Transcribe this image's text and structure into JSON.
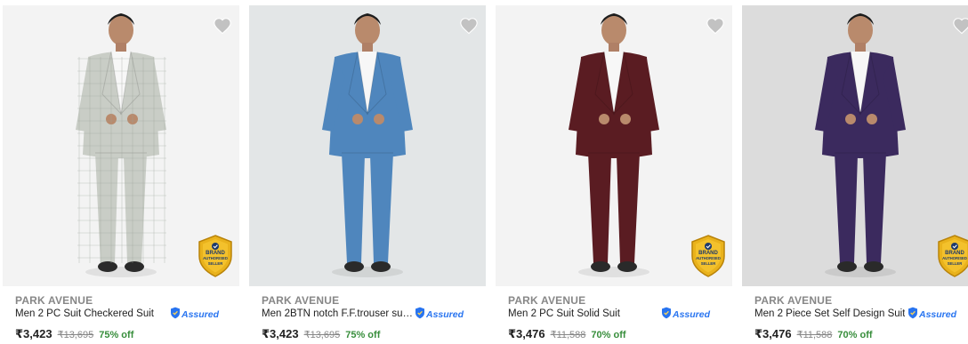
{
  "theme": {
    "accent": "#2874f0",
    "discount": "#388e3c",
    "muted": "#878787"
  },
  "wishlist_icon": "heart-icon",
  "assured_label": "Assured",
  "products": [
    {
      "brand": "PARK AVENUE",
      "title": "Men 2 PC Suit Checkered Suit",
      "price": "₹3,423",
      "mrp": "₹13,695",
      "discount": "75% off",
      "seal": [
        "BRAND",
        "AUTHORISED",
        "SELLER"
      ],
      "suit_color": "#c9cdc6",
      "bg_color": "#f3f3f3"
    },
    {
      "brand": "PARK AVENUE",
      "title": "Men 2BTN notch F.F.trouser sup...",
      "price": "₹3,423",
      "mrp": "₹13,695",
      "discount": "75% off",
      "seal": null,
      "suit_color": "#4f86bd",
      "bg_color": "#e3e6e7"
    },
    {
      "brand": "PARK AVENUE",
      "title": "Men 2 PC Suit Solid Suit",
      "price": "₹3,476",
      "mrp": "₹11,588",
      "discount": "70% off",
      "seal": [
        "BRAND",
        "AUTHORISED",
        "SELLER"
      ],
      "suit_color": "#5a1c22",
      "bg_color": "#f3f3f3"
    },
    {
      "brand": "PARK AVENUE",
      "title": "Men 2 Piece Set Self Design Suit",
      "price": "₹3,476",
      "mrp": "₹11,588",
      "discount": "70% off",
      "seal": [
        "BRAND",
        "AUTHORISED",
        "SELLER"
      ],
      "suit_color": "#3b2a5e",
      "bg_color": "#dcdcdc"
    }
  ]
}
